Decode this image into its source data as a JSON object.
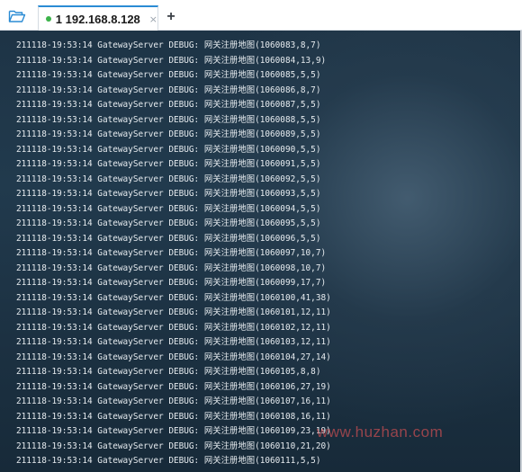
{
  "tabbar": {
    "folder_icon": "folder-open-icon",
    "active_tab": {
      "status_icon": "connected-dot-icon",
      "status_color": "#3cb34a",
      "label": "1 192.168.8.128",
      "close_glyph": "×"
    },
    "add_tab_glyph": "+"
  },
  "terminal": {
    "background_color": "#1e3446",
    "text_color": "#e6ebef",
    "lines": [
      "211118-19:53:14 GatewayServer DEBUG: 网关注册地图(1060083,8,7)",
      "211118-19:53:14 GatewayServer DEBUG: 网关注册地图(1060084,13,9)",
      "211118-19:53:14 GatewayServer DEBUG: 网关注册地图(1060085,5,5)",
      "211118-19:53:14 GatewayServer DEBUG: 网关注册地图(1060086,8,7)",
      "211118-19:53:14 GatewayServer DEBUG: 网关注册地图(1060087,5,5)",
      "211118-19:53:14 GatewayServer DEBUG: 网关注册地图(1060088,5,5)",
      "211118-19:53:14 GatewayServer DEBUG: 网关注册地图(1060089,5,5)",
      "211118-19:53:14 GatewayServer DEBUG: 网关注册地图(1060090,5,5)",
      "211118-19:53:14 GatewayServer DEBUG: 网关注册地图(1060091,5,5)",
      "211118-19:53:14 GatewayServer DEBUG: 网关注册地图(1060092,5,5)",
      "211118-19:53:14 GatewayServer DEBUG: 网关注册地图(1060093,5,5)",
      "211118-19:53:14 GatewayServer DEBUG: 网关注册地图(1060094,5,5)",
      "211118-19:53:14 GatewayServer DEBUG: 网关注册地图(1060095,5,5)",
      "211118-19:53:14 GatewayServer DEBUG: 网关注册地图(1060096,5,5)",
      "211118-19:53:14 GatewayServer DEBUG: 网关注册地图(1060097,10,7)",
      "211118-19:53:14 GatewayServer DEBUG: 网关注册地图(1060098,10,7)",
      "211118-19:53:14 GatewayServer DEBUG: 网关注册地图(1060099,17,7)",
      "211118-19:53:14 GatewayServer DEBUG: 网关注册地图(1060100,41,38)",
      "211118-19:53:14 GatewayServer DEBUG: 网关注册地图(1060101,12,11)",
      "211118-19:53:14 GatewayServer DEBUG: 网关注册地图(1060102,12,11)",
      "211118-19:53:14 GatewayServer DEBUG: 网关注册地图(1060103,12,11)",
      "211118-19:53:14 GatewayServer DEBUG: 网关注册地图(1060104,27,14)",
      "211118-19:53:14 GatewayServer DEBUG: 网关注册地图(1060105,8,8)",
      "211118-19:53:14 GatewayServer DEBUG: 网关注册地图(1060106,27,19)",
      "211118-19:53:14 GatewayServer DEBUG: 网关注册地图(1060107,16,11)",
      "211118-19:53:14 GatewayServer DEBUG: 网关注册地图(1060108,16,11)",
      "211118-19:53:14 GatewayServer DEBUG: 网关注册地图(1060109,23,19)",
      "211118-19:53:14 GatewayServer DEBUG: 网关注册地图(1060110,21,20)",
      "211118-19:53:14 GatewayServer DEBUG: 网关注册地图(1060111,5,5)"
    ]
  },
  "watermark": {
    "text": "www.huzhan.com",
    "color": "#ff5a5a"
  }
}
